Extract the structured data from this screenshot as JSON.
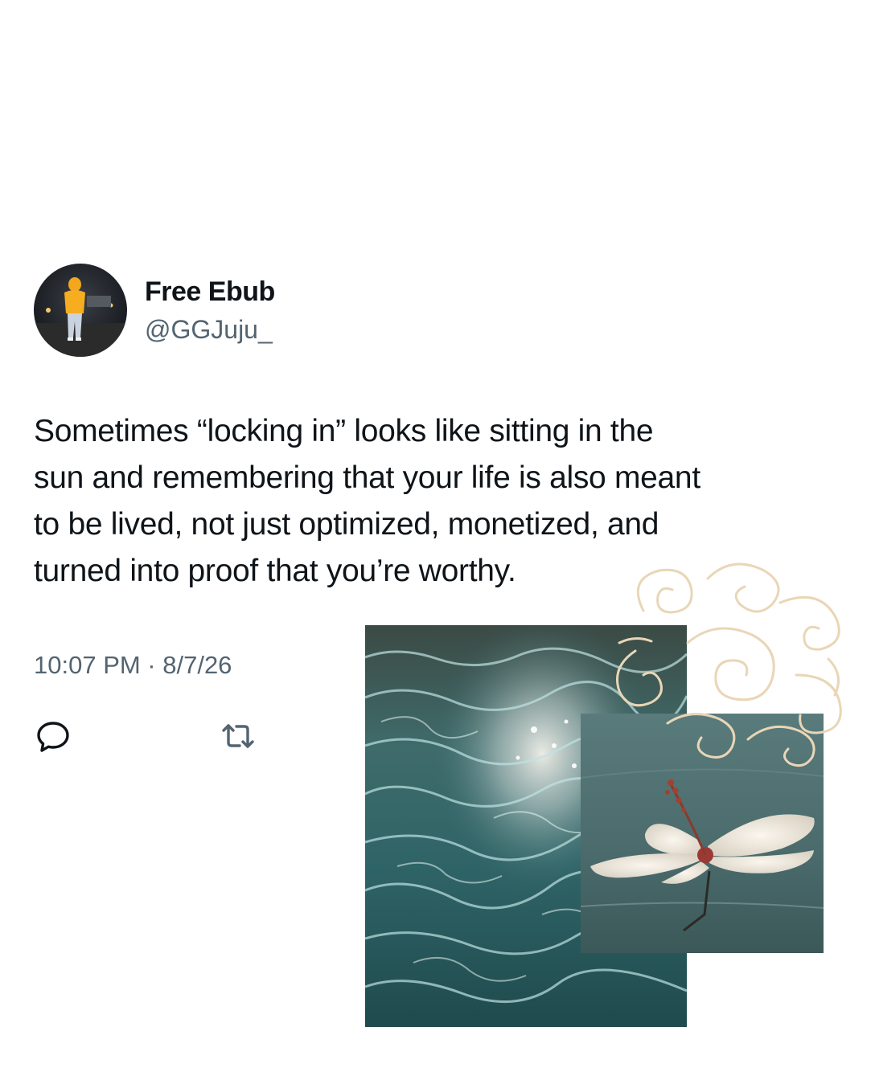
{
  "tweet": {
    "display_name": "Free Ebub",
    "handle": "@GGJuju_",
    "text_lines": [
      "Sometimes “locking in” looks like sitting in the",
      "sun and remembering that your life is also meant",
      "to be lived, not just optimized, monetized, and",
      "turned into proof that you’re worthy."
    ],
    "timestamp": "10:07 PM · 8/7/26"
  },
  "actions": {
    "reply_icon": "speech-bubble-icon",
    "retweet_icon": "retweet-arrows-icon"
  },
  "colors": {
    "text_primary": "#0f1419",
    "text_secondary": "#536471",
    "doodle_stroke": "#e9d6b6",
    "water_base": "#2f5a5c",
    "flower_background": "#4c6b6d"
  }
}
